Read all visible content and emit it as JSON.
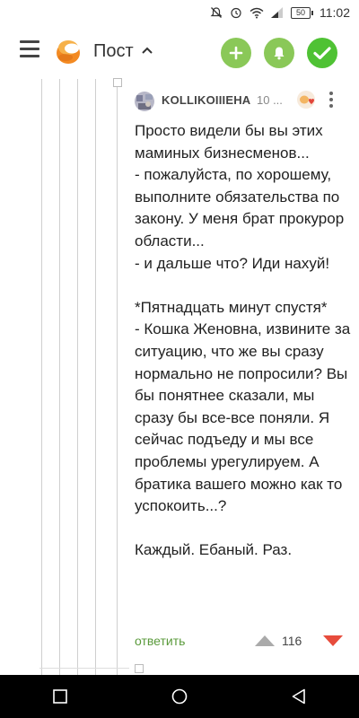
{
  "status_bar": {
    "battery": "50",
    "time": "11:02"
  },
  "app_bar": {
    "title": "Пост"
  },
  "comment": {
    "author": "KOLLIKOIIIEHA",
    "time_ago": "10 ...",
    "paragraphs": [
      "Просто видели бы вы этих маминых бизнесменов...",
      "- пожалуйста, по хорошему, выполните обязательства по закону. У меня брат прокурор области...",
      "- и дальше что? Иди нахуй!",
      "",
      "*Пятнадцать минут спустя*",
      "- Кошка Женовна, извините за ситуацию, что же вы сразу нормально не попросили? Вы бы понятнее сказали, мы сразу бы все-все поняли. Я сейчас подъеду и мы все проблемы урегулируем. А братика вашего можно как то успокоить...?",
      "",
      "Каждый. Ебаный. Раз."
    ],
    "reply_label": "ответить",
    "rating": "116"
  },
  "colors": {
    "accent_green": "#8ac858",
    "check_green": "#4fc234",
    "reply_green": "#5a9a3b",
    "downvote_red": "#e74c3c",
    "upvote_gray": "#aaaaaa"
  },
  "icons": {
    "menu": "menu-icon",
    "logo": "pikabu-logo-icon",
    "add": "plus-icon",
    "notify": "bell-icon",
    "check": "check-icon",
    "more": "more-vertical-icon",
    "upvote": "upvote-icon",
    "downvote": "downvote-icon"
  }
}
